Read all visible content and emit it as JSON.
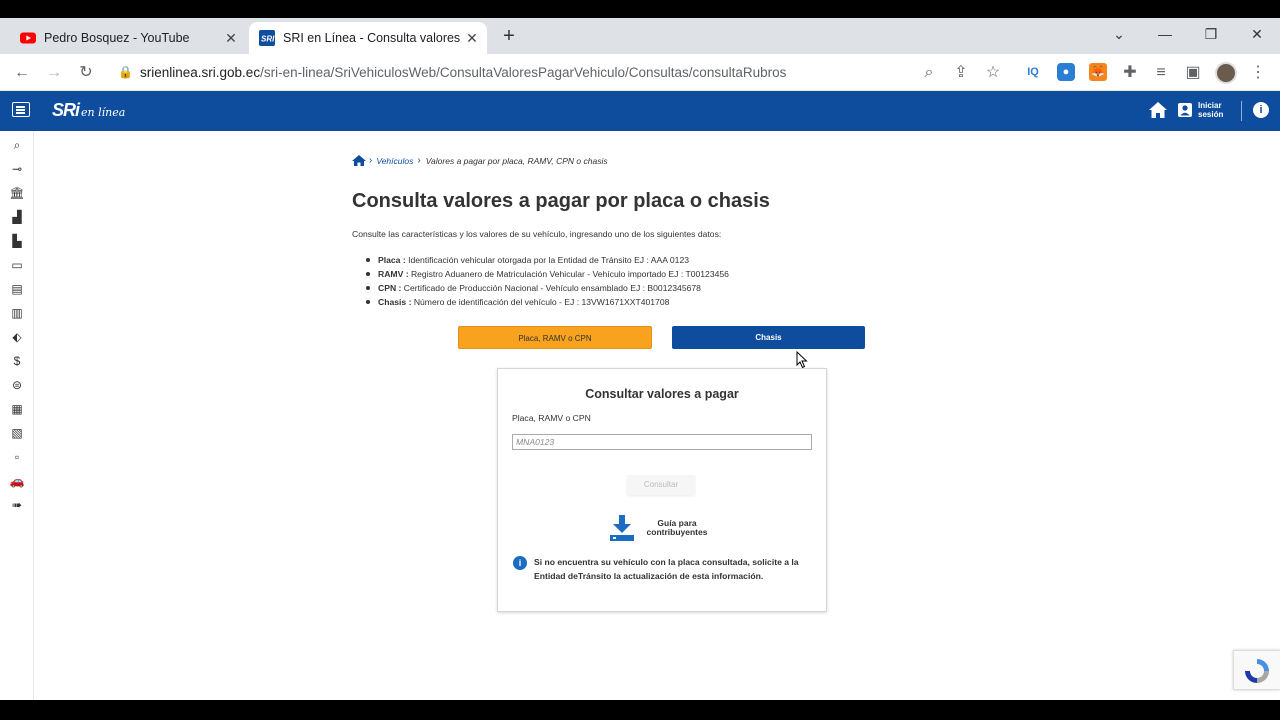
{
  "browser": {
    "tabs": [
      {
        "title": "Pedro Bosquez - YouTube"
      },
      {
        "title": "SRI en Línea - Consulta valores a pagar"
      }
    ],
    "address": {
      "domain": "srienlinea.sri.gob.ec",
      "path": "/sri-en-linea/SriVehiculosWeb/ConsultaValoresPagarVehiculo/Consultas/consultaRubros"
    }
  },
  "header": {
    "logo_main": "SRi",
    "logo_sub": "en línea",
    "login_label_1": "Iniciar",
    "login_label_2": "sesión"
  },
  "breadcrumb": {
    "link": "Vehículos",
    "current": "Valores a pagar por placa, RAMV, CPN o chasis"
  },
  "page": {
    "title": "Consulta valores a pagar por placa o chasis",
    "intro": "Consulte las características y los valores de su vehículo, ingresando uno de los siguientes datos:",
    "items": [
      {
        "term": "Placa :",
        "desc": " Identificación vehicular otorgada por la Entidad de Tránsito EJ : AAA 0123"
      },
      {
        "term": "RAMV :",
        "desc": " Registro Aduanero de Matriculación Vehicular - Vehículo importado EJ : T00123456"
      },
      {
        "term": "CPN :",
        "desc": " Certificado de Producción Nacional - Vehículo ensamblado EJ : B0012345678"
      },
      {
        "term": "Chasis :",
        "desc": " Número de identificación del vehículo - EJ : 13VW1671XXT401708"
      }
    ],
    "btn_placa": "Placa, RAMV o CPN",
    "btn_chasis": "Chasis"
  },
  "card": {
    "title": "Consultar valores a pagar",
    "field_label": "Placa, RAMV o CPN",
    "placeholder": "MNA0123",
    "consult_label": "Consultar",
    "guide_1": "Guía para",
    "guide_2": "contribuyentes",
    "note": "Si no encuentra su vehículo con la placa consultada, solicite a la Entidad deTránsito la actualización de esta información."
  },
  "colors": {
    "brand": "#0e4c9d",
    "accent": "#f8a21d"
  }
}
